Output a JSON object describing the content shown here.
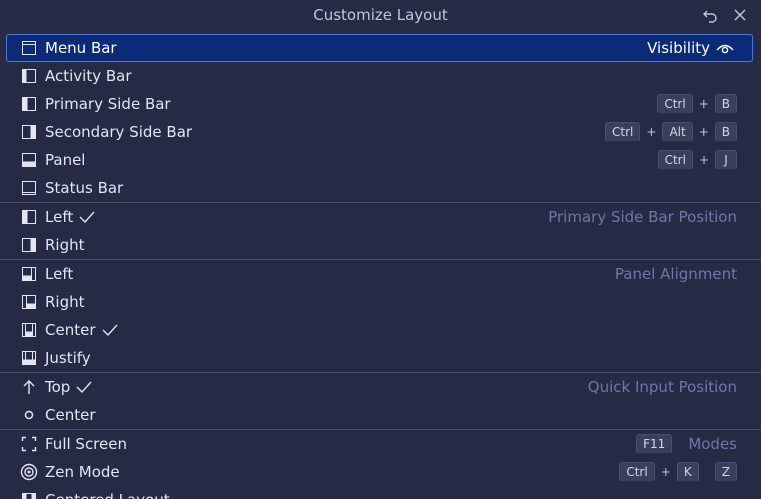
{
  "window": {
    "title": "Customize Layout"
  },
  "visibility": {
    "items": [
      {
        "label": "Menu Bar",
        "icon": "menu-bar-icon",
        "selected": true
      },
      {
        "label": "Activity Bar",
        "icon": "activity-bar-icon"
      },
      {
        "label": "Primary Side Bar",
        "icon": "primary-side-bar-icon",
        "keys": [
          "Ctrl",
          "B"
        ]
      },
      {
        "label": "Secondary Side Bar",
        "icon": "secondary-side-bar-icon",
        "keys": [
          "Ctrl",
          "Alt",
          "B"
        ]
      },
      {
        "label": "Panel",
        "icon": "panel-icon",
        "keys": [
          "Ctrl",
          "J"
        ]
      },
      {
        "label": "Status Bar",
        "icon": "status-bar-icon"
      }
    ],
    "group_label": "Visibility"
  },
  "side_bar_position": {
    "group_label": "Primary Side Bar Position",
    "items": [
      {
        "label": "Left",
        "checked": true
      },
      {
        "label": "Right"
      }
    ]
  },
  "panel_alignment": {
    "group_label": "Panel Alignment",
    "items": [
      {
        "label": "Left"
      },
      {
        "label": "Right"
      },
      {
        "label": "Center",
        "checked": true
      },
      {
        "label": "Justify"
      }
    ]
  },
  "quick_input": {
    "group_label": "Quick Input Position",
    "items": [
      {
        "label": "Top",
        "checked": true
      },
      {
        "label": "Center"
      }
    ]
  },
  "modes": {
    "group_label": "Modes",
    "items": [
      {
        "label": "Full Screen",
        "keys": [
          "F11"
        ]
      },
      {
        "label": "Zen Mode",
        "chord": [
          [
            "Ctrl",
            "K"
          ],
          [
            "Z"
          ]
        ]
      },
      {
        "label": "Centered Layout"
      }
    ]
  },
  "plus": "+",
  "colors": {
    "background": "#262a45",
    "selection": "#0b2a77",
    "accent_border": "#4c78d8",
    "group_label": "#6e78a8"
  }
}
